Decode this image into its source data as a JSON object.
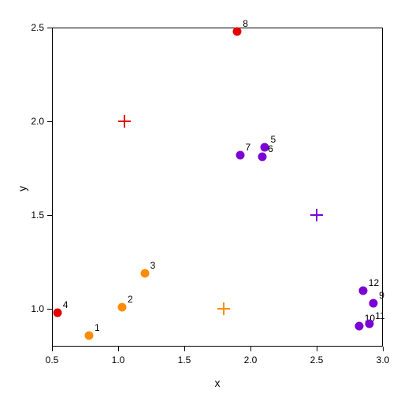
{
  "chart_data": {
    "type": "scatter",
    "xlabel": "x",
    "ylabel": "y",
    "xlim": [
      0.5,
      3.0
    ],
    "ylim": [
      0.8,
      2.5
    ],
    "x_ticks": [
      0.5,
      1.0,
      1.5,
      2.0,
      2.5,
      3.0
    ],
    "y_ticks": [
      1.0,
      1.5,
      2.0,
      2.5
    ],
    "points": [
      {
        "id": "1",
        "x": 0.78,
        "y": 0.86,
        "color": "#FF8C00",
        "label": "1"
      },
      {
        "id": "2",
        "x": 1.03,
        "y": 1.01,
        "color": "#FF8C00",
        "label": "2"
      },
      {
        "id": "3",
        "x": 1.2,
        "y": 1.19,
        "color": "#FF8C00",
        "label": "3"
      },
      {
        "id": "4",
        "x": 0.54,
        "y": 0.98,
        "color": "#E40000",
        "label": "4"
      },
      {
        "id": "5",
        "x": 2.11,
        "y": 1.86,
        "color": "#7B00D3",
        "label": "5"
      },
      {
        "id": "6",
        "x": 2.09,
        "y": 1.81,
        "color": "#7B00D3",
        "label": "6"
      },
      {
        "id": "7",
        "x": 1.92,
        "y": 1.82,
        "color": "#7B00D3",
        "label": "7"
      },
      {
        "id": "8",
        "x": 1.9,
        "y": 2.48,
        "color": "#E40000",
        "label": "8"
      },
      {
        "id": "9",
        "x": 2.93,
        "y": 1.03,
        "color": "#7B00D3",
        "label": "9"
      },
      {
        "id": "10",
        "x": 2.82,
        "y": 0.91,
        "color": "#7B00D3",
        "label": "10"
      },
      {
        "id": "11",
        "x": 2.9,
        "y": 0.92,
        "color": "#7B00D3",
        "label": "11"
      },
      {
        "id": "12",
        "x": 2.85,
        "y": 1.1,
        "color": "#7B00D3",
        "label": "12"
      }
    ],
    "centroids": [
      {
        "id": "c-orange",
        "x": 1.8,
        "y": 1.0,
        "color": "#FF8C00"
      },
      {
        "id": "c-red",
        "x": 1.05,
        "y": 2.0,
        "color": "#E40000"
      },
      {
        "id": "c-purple",
        "x": 2.5,
        "y": 1.5,
        "color": "#7B00D3"
      }
    ]
  }
}
